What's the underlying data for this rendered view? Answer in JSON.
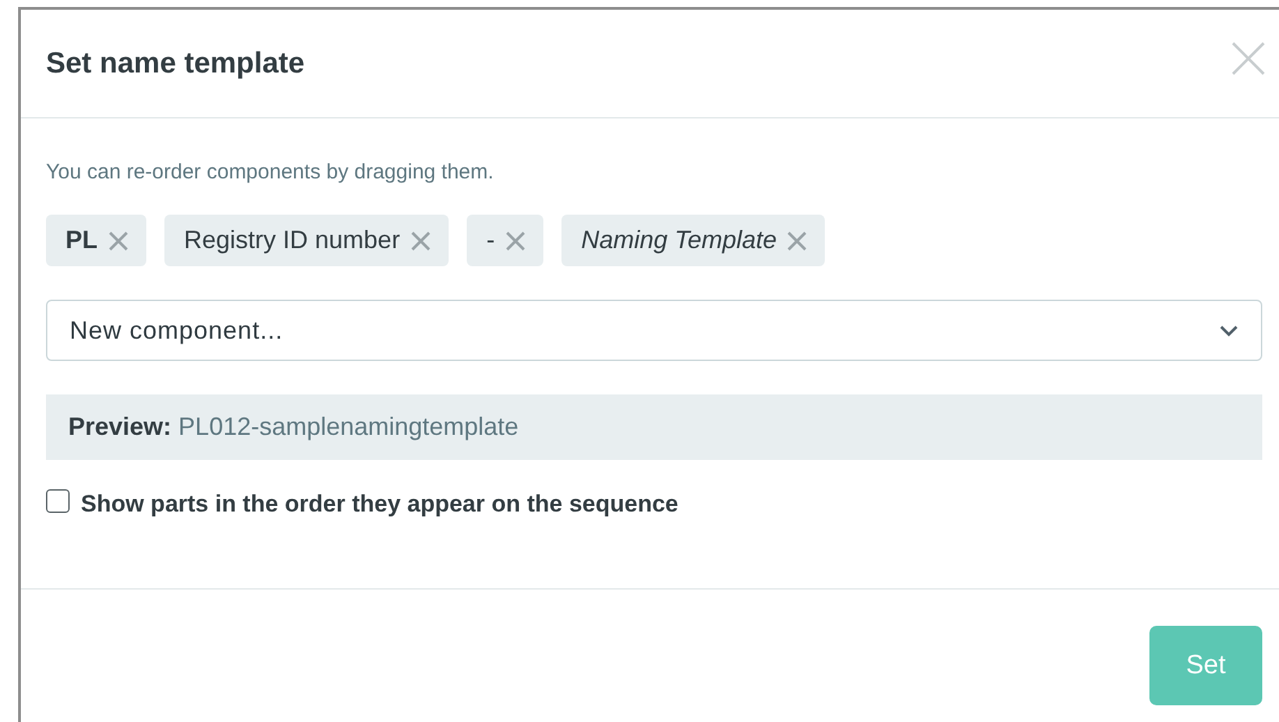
{
  "dialog": {
    "title": "Set name template"
  },
  "hint": "You can re-order components by dragging them.",
  "components": [
    {
      "kind": "bold",
      "label": "PL"
    },
    {
      "kind": "plain",
      "label": "Registry ID number"
    },
    {
      "kind": "plain",
      "label": "-"
    },
    {
      "kind": "italic",
      "label": "Naming Template"
    }
  ],
  "new_component": {
    "placeholder": "New component..."
  },
  "preview": {
    "label": "Preview:",
    "value": "PL012-samplenamingtemplate"
  },
  "order_option": {
    "label": "Show parts in the order they appear on the sequence",
    "checked": false
  },
  "buttons": [
    {
      "label": "Set",
      "disabled": true
    }
  ]
}
